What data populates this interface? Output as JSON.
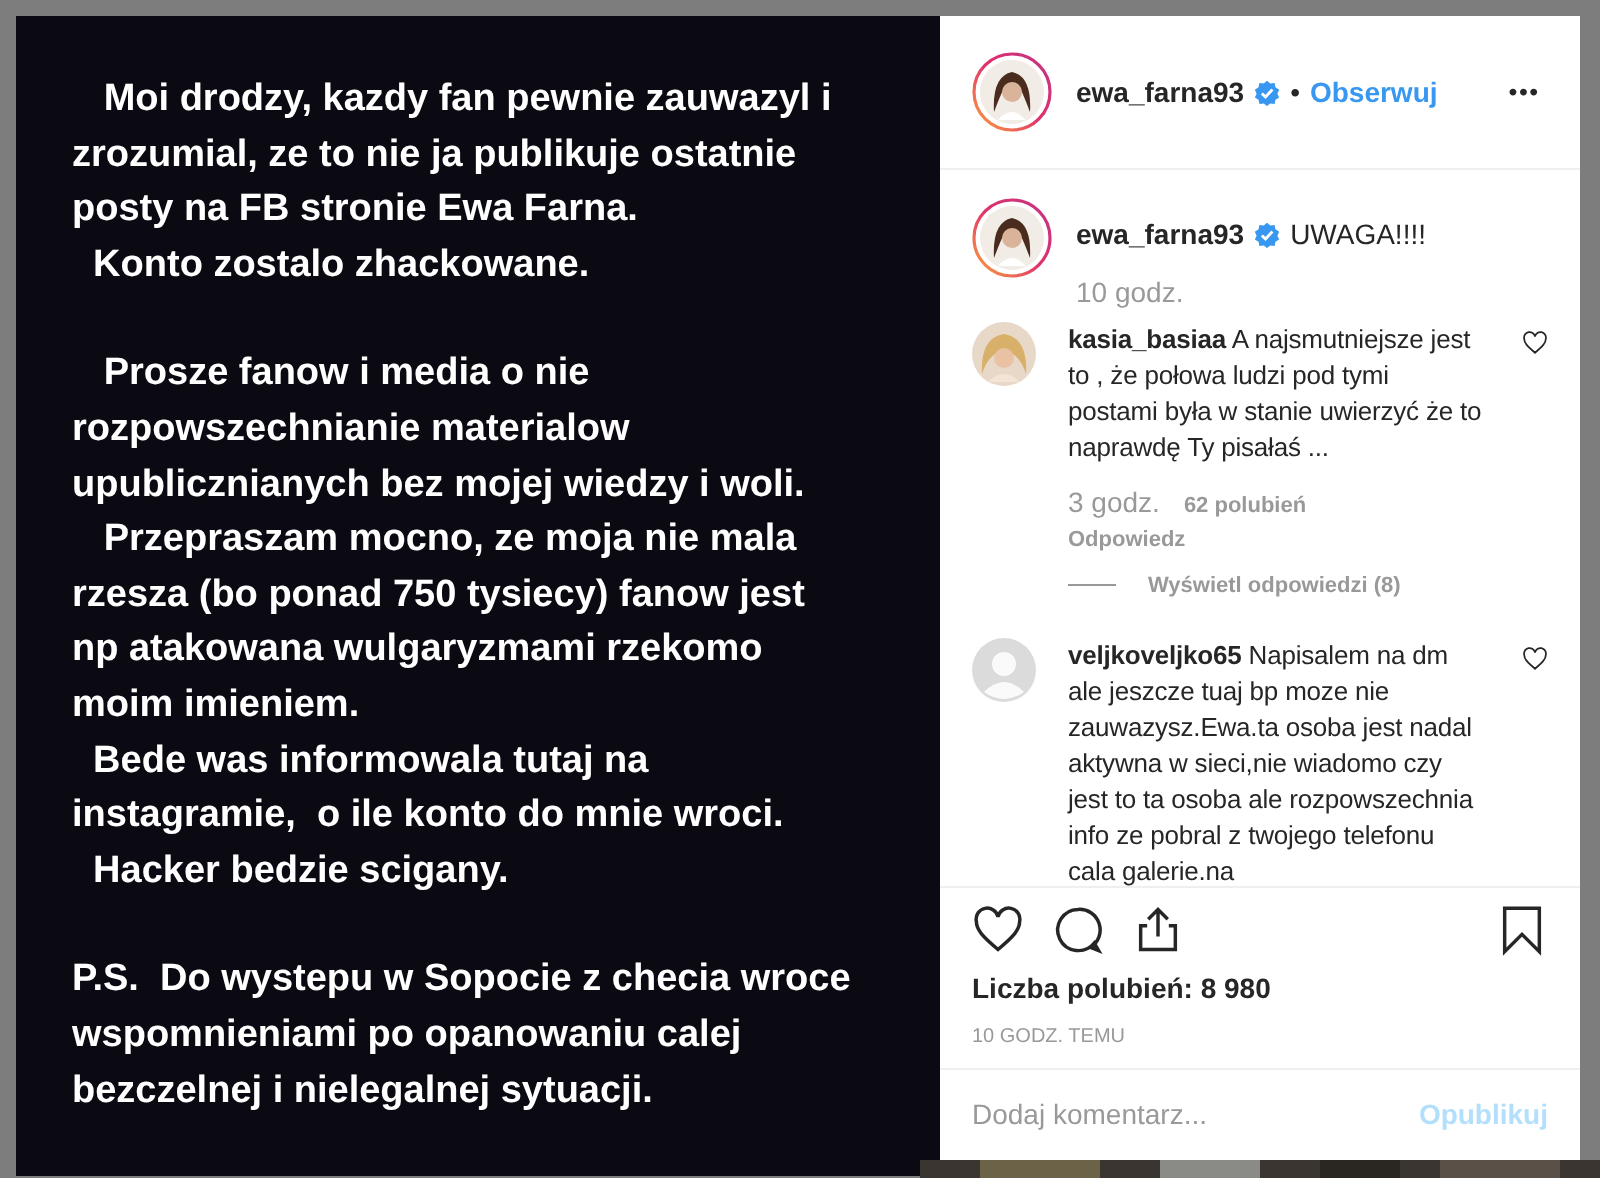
{
  "post_image": {
    "paragraphs": [
      {
        "lines": [
          "   Moi drodzy, kazdy fan pewnie zauwazyl i",
          "zrozumial, ze to nie ja publikuje ostatnie",
          "posty na FB stronie Ewa Farna.",
          "  Konto zostalo zhackowane."
        ]
      },
      {
        "lines": [
          "   Prosze fanow i media o nie",
          "rozpowszechnianie materialow",
          "upublicznianych bez mojej wiedzy i woli.",
          "   Przepraszam mocno, ze moja nie mala",
          "rzesza (bo ponad 750 tysiecy) fanow jest",
          "np atakowana wulgaryzmami rzekomo",
          "moim imieniem.",
          "  Bede was informowala tutaj na",
          "instagramie,  o ile konto do mnie wroci.",
          "  Hacker bedzie scigany."
        ]
      },
      {
        "lines": [
          "P.S.  Do wystepu w Sopocie z checia wroce",
          "wspomnieniami po opanowaniu calej",
          "bezczelnej i nielegalnej sytuacji."
        ]
      }
    ]
  },
  "header": {
    "username": "ewa_farna93",
    "verified": true,
    "separator": "•",
    "follow": "Obserwuj",
    "more": "•••"
  },
  "caption": {
    "username": "ewa_farna93",
    "verified": true,
    "text": "UWAGA!!!!",
    "time": "10 godz."
  },
  "comments": [
    {
      "username": "kasia_basiaa",
      "text": "A najsmutniejsze jest to , że połowa ludzi pod tymi postami była w stanie uwierzyć że to naprawdę Ty pisałaś ...",
      "liked": false,
      "time": "3 godz.",
      "likes": "62 polubień",
      "reply": "Odpowiedz",
      "view_replies": "Wyświetl odpowiedzi (8)"
    },
    {
      "kind": "default",
      "username": "veljkoveljko65",
      "text": "Napisalem na dm ale jeszcze tuaj bp moze nie zauwazysz.Ewa.ta osoba jest nadal aktywna w sieci,nie wiadomo czy jest to ta osoba ale rozpowszechnia info ze pobral z twojego telefonu cala galerie.na",
      "liked": false
    }
  ],
  "likes": "Liczba polubień: 8 980",
  "timestamp": "10 GODZ. TEMU",
  "comment_field": {
    "placeholder": "Dodaj komentarz...",
    "submit": "Opublikuj"
  }
}
